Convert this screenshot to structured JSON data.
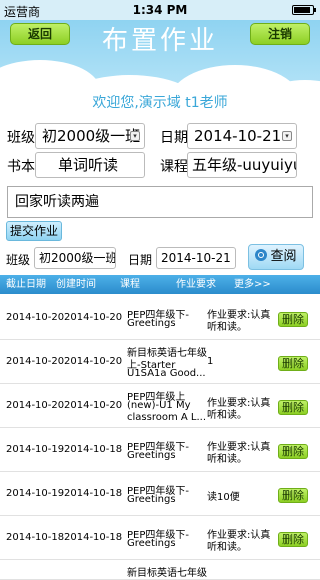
{
  "status": {
    "carrier": "运营商",
    "time": "1:34 PM",
    "battery_level": 0.9
  },
  "header": {
    "title": "布置作业",
    "back_label": "返回",
    "logout_label": "注销"
  },
  "welcome": "欢迎您,演示域 t1老师",
  "form": {
    "class_label": "班级",
    "class_value": "初2000级一班",
    "date_label": "日期",
    "date_value": "2014-10-21",
    "book_label": "书本",
    "book_value": "单词听读",
    "course_label": "课程",
    "course_value": "五年级-uuyuiyu",
    "homework_text": "回家听读两遍",
    "submit_label": "提交作业"
  },
  "search": {
    "class_label": "班级",
    "class_value": "初2000级一班",
    "date_label": "日期",
    "date_value": "2014-10-21",
    "search_label": "查阅"
  },
  "table": {
    "headers": [
      "截止日期",
      "创建时间",
      "课程",
      "作业要求",
      "更多>>"
    ],
    "rows": [
      {
        "due": "2014-10-20",
        "created": "2014-10-20",
        "course_lines": [
          "PEP四年级下-",
          "Greetings"
        ],
        "req_lines": [
          "作业要求:认真",
          "听和读。"
        ],
        "action": "删除"
      },
      {
        "due": "2014-10-20",
        "created": "2014-10-20",
        "course_lines": [
          "新目标英语七年级",
          "上-Starter",
          "U1SA1a Good..."
        ],
        "req_lines": [
          "1"
        ],
        "action": "删除"
      },
      {
        "due": "2014-10-20",
        "created": "2014-10-20",
        "course_lines": [
          "PEP四年级上",
          "(new)-U1 My",
          "classroom A L..."
        ],
        "req_lines": [
          "作业要求:认真",
          "听和读。"
        ],
        "action": "删除"
      },
      {
        "due": "2014-10-19",
        "created": "2014-10-18",
        "course_lines": [
          "PEP四年级下-",
          "Greetings"
        ],
        "req_lines": [
          "作业要求:认真",
          "听和读。"
        ],
        "action": "删除"
      },
      {
        "due": "2014-10-19",
        "created": "2014-10-18",
        "course_lines": [
          "PEP四年级下-",
          "Greetings"
        ],
        "req_lines": [
          "读10便"
        ],
        "action": "删除"
      },
      {
        "due": "2014-10-18",
        "created": "2014-10-18",
        "course_lines": [
          "PEP四年级下-",
          "Greetings"
        ],
        "req_lines": [
          "作业要求:认真",
          "听和读。"
        ],
        "action": "删除"
      },
      {
        "due": "",
        "created": "",
        "course_lines": [
          "新目标英语七年级"
        ],
        "req_lines": [],
        "action": ""
      }
    ]
  }
}
